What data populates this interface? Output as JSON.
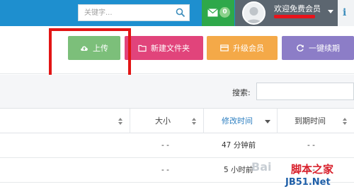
{
  "topbar": {
    "search_placeholder": "关键字...",
    "message_count": "0",
    "user_name": "欢迎免费会员",
    "info_label": "i"
  },
  "toolbar": {
    "upload": "上传",
    "new_folder": "新建文件夹",
    "upgrade": "升级会员",
    "renew": "一键续期"
  },
  "search": {
    "label": "搜索:",
    "value": ""
  },
  "table": {
    "headers": {
      "size": "大小",
      "modified": "修改时间",
      "expires": "到期时间"
    },
    "rows": [
      {
        "size": "- -",
        "modified": "47 分钟前",
        "expires": "- -"
      },
      {
        "size": "- -",
        "modified": "5 小时前",
        "expires": "- -"
      }
    ]
  },
  "watermark": {
    "brand": "Bai",
    "site": "脚本之家",
    "url": "JB51.Net"
  },
  "colors": {
    "topbar": "#1e8fcf",
    "message": "#2ea84a",
    "upload": "#7cbf7a",
    "new_folder": "#e1447b",
    "upgrade": "#f4a948",
    "renew": "#8c7dc7",
    "highlight": "#e21515"
  },
  "icons": {
    "search": "search-icon",
    "envelope": "envelope-icon",
    "upload": "cloud-upload-icon",
    "folder": "folder-icon",
    "card": "card-icon",
    "renew": "refresh-icon",
    "info": "info-icon"
  }
}
